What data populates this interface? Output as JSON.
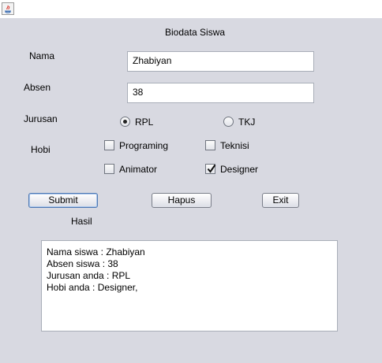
{
  "window": {
    "icon": "java-icon"
  },
  "form": {
    "title": "Biodata Siswa",
    "nama": {
      "label": "Nama",
      "value": "Zhabiyan"
    },
    "absen": {
      "label": "Absen",
      "value": "38"
    },
    "jurusan": {
      "label": "Jurusan",
      "options": [
        {
          "label": "RPL",
          "selected": true
        },
        {
          "label": "TKJ",
          "selected": false
        }
      ]
    },
    "hobi": {
      "label": "Hobi",
      "options": [
        {
          "label": "Programing",
          "checked": false
        },
        {
          "label": "Teknisi",
          "checked": false
        },
        {
          "label": "Animator",
          "checked": false
        },
        {
          "label": "Designer",
          "checked": true
        }
      ]
    },
    "buttons": {
      "submit": "Submit",
      "hapus": "Hapus",
      "exit": "Exit"
    },
    "hasil_label": "Hasil",
    "output_lines": [
      "Nama siswa : Zhabiyan",
      "Absen siswa : 38",
      "Jurusan anda : RPL",
      "Hobi anda : Designer,"
    ]
  }
}
